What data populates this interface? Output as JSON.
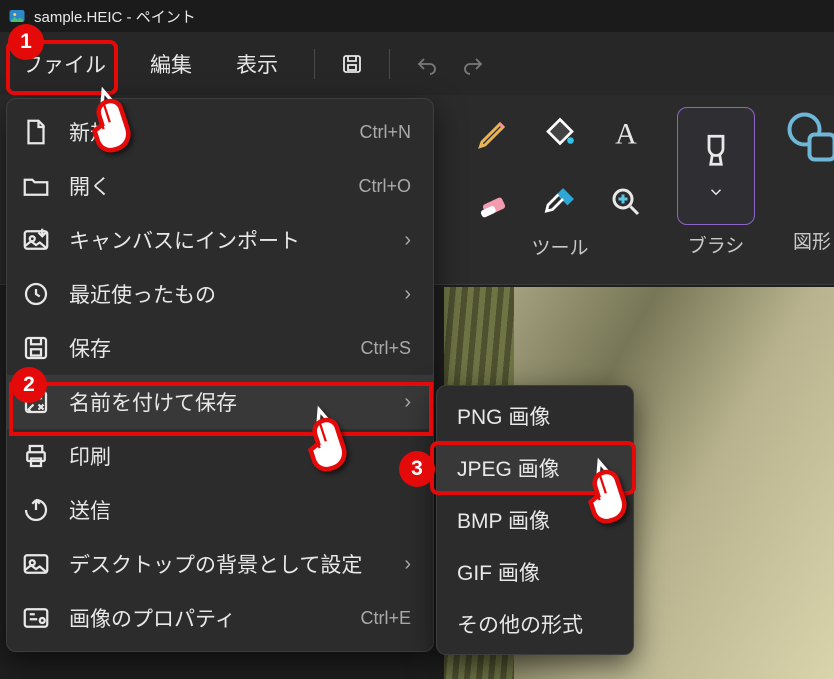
{
  "window": {
    "title": "sample.HEIC - ペイント"
  },
  "menubar": {
    "file": "ファイル",
    "edit": "編集",
    "view": "表示"
  },
  "ribbon": {
    "tools_label": "ツール",
    "brush_label": "ブラシ",
    "shapes_label": "図形"
  },
  "file_menu": [
    {
      "icon": "new-icon",
      "label": "新規",
      "accel": "Ctrl+N",
      "chev": false
    },
    {
      "icon": "open-icon",
      "label": "開く",
      "accel": "Ctrl+O",
      "chev": false
    },
    {
      "icon": "import-icon",
      "label": "キャンバスにインポート",
      "accel": "",
      "chev": true
    },
    {
      "icon": "recent-icon",
      "label": "最近使ったもの",
      "accel": "",
      "chev": true
    },
    {
      "icon": "save-icon",
      "label": "保存",
      "accel": "Ctrl+S",
      "chev": false
    },
    {
      "icon": "saveas-icon",
      "label": "名前を付けて保存",
      "accel": "",
      "chev": true
    },
    {
      "icon": "print-icon",
      "label": "印刷",
      "accel": "",
      "chev": false
    },
    {
      "icon": "send-icon",
      "label": "送信",
      "accel": "",
      "chev": false
    },
    {
      "icon": "wallpaper-icon",
      "label": "デスクトップの背景として設定",
      "accel": "",
      "chev": true
    },
    {
      "icon": "properties-icon",
      "label": "画像のプロパティ",
      "accel": "Ctrl+E",
      "chev": false
    }
  ],
  "saveas_submenu": [
    {
      "label": "PNG 画像"
    },
    {
      "label": "JPEG 画像"
    },
    {
      "label": "BMP 画像"
    },
    {
      "label": "GIF 画像"
    },
    {
      "label": "その他の形式"
    }
  ],
  "annotations": {
    "one": "1",
    "two": "2",
    "three": "3"
  }
}
